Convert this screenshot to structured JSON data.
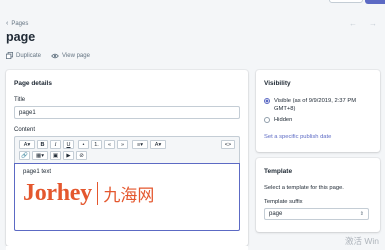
{
  "breadcrumb": {
    "label": "Pages"
  },
  "page": {
    "title": "page"
  },
  "actions": {
    "duplicate": "Duplicate",
    "view": "View page"
  },
  "details": {
    "heading": "Page details",
    "title_label": "Title",
    "title_value": "page1",
    "content_label": "Content",
    "editor_text": "page1 text"
  },
  "toolbar": {
    "row1": [
      "A",
      "B",
      "I",
      "U",
      "•",
      "1.",
      "«",
      "»",
      "≡",
      "A",
      "<>"
    ],
    "row2": [
      "🔗",
      "▦",
      "▣",
      "▶",
      "⊘"
    ]
  },
  "logo": {
    "en": "Jorhey",
    "cn": "九海网"
  },
  "visibility": {
    "heading": "Visibility",
    "visible_label": "Visible (as of 9/9/2019, 2:37 PM GMT+8)",
    "hidden_label": "Hidden",
    "publish_link": "Set a specific publish date"
  },
  "template": {
    "heading": "Template",
    "description": "Select a template for this page.",
    "suffix_label": "Template suffix",
    "suffix_value": "page"
  },
  "watermark": "激活 Win",
  "colors": {
    "accent": "#5c6ac4",
    "logo": "#e4572e",
    "background": "#f4f6f8"
  }
}
